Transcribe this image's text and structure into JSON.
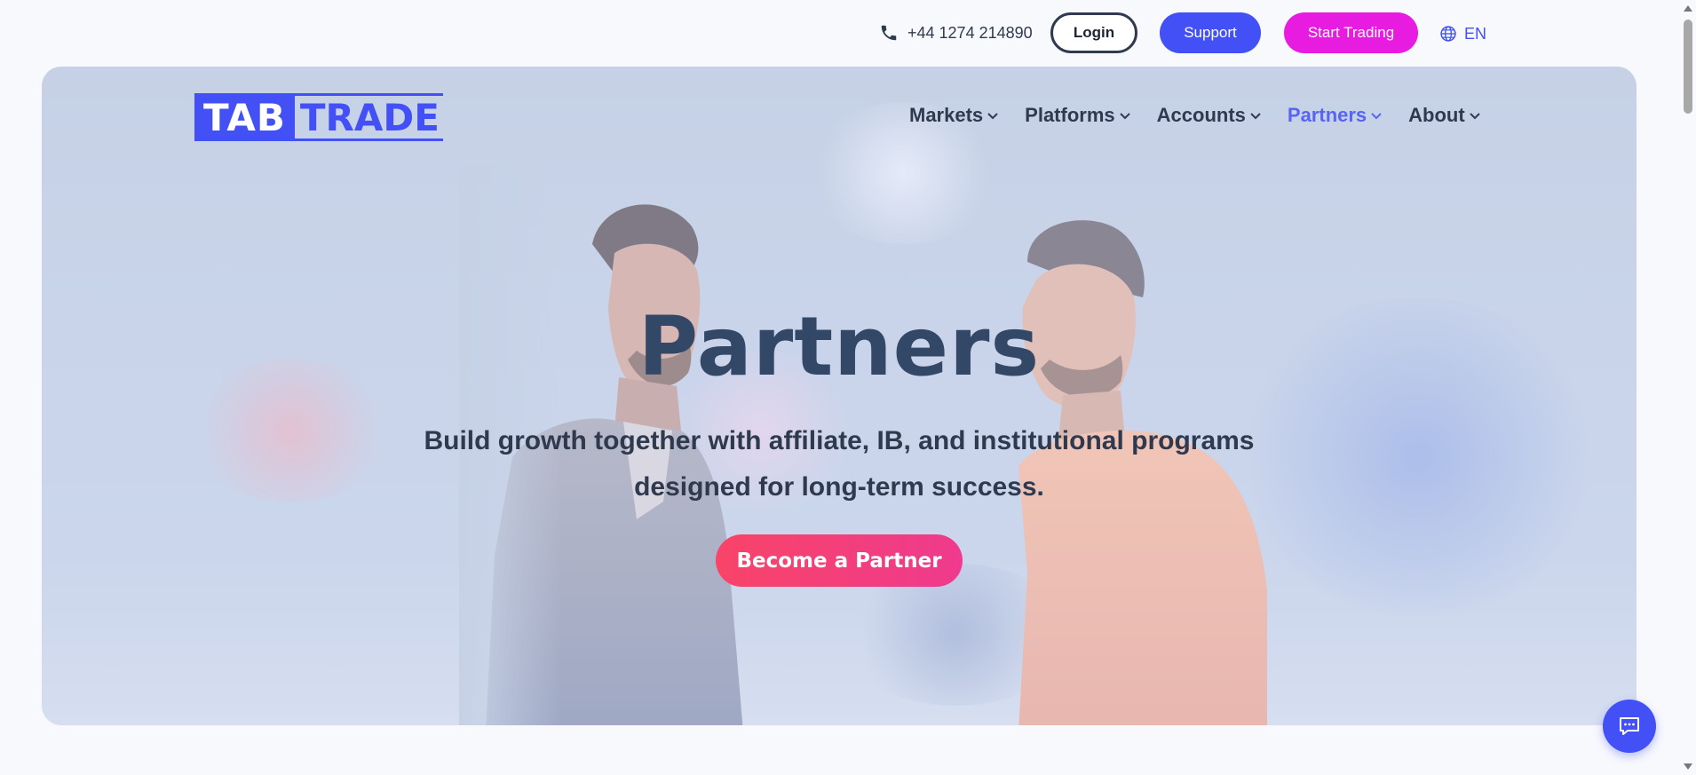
{
  "topbar": {
    "phone": "+44 1274 214890",
    "login_label": "Login",
    "support_label": "Support",
    "start_label": "Start Trading",
    "language": "EN"
  },
  "logo": {
    "part1": "TAB",
    "part2": "TRADE"
  },
  "nav": {
    "items": [
      {
        "label": "Markets"
      },
      {
        "label": "Platforms"
      },
      {
        "label": "Accounts"
      },
      {
        "label": "Partners"
      },
      {
        "label": "About"
      }
    ],
    "active": "Partners"
  },
  "hero": {
    "title": "Partners",
    "subtitle_line1": "Build growth together with affiliate, IB, and institutional programs",
    "subtitle_line2": "designed for long-term success.",
    "cta_label": "Become a Partner"
  },
  "colors": {
    "brand": "#4350f5",
    "start_trading": "#e81be0",
    "cta_gradient_start": "#f84468",
    "cta_gradient_end": "#ef3a8e",
    "nav_active": "#5865f2",
    "text_dark": "#2f3a4f"
  },
  "icons": {
    "phone": "phone-icon",
    "language": "globe-icon",
    "nav_dropdown": "chevron-down-icon",
    "chat": "chat-icon"
  }
}
